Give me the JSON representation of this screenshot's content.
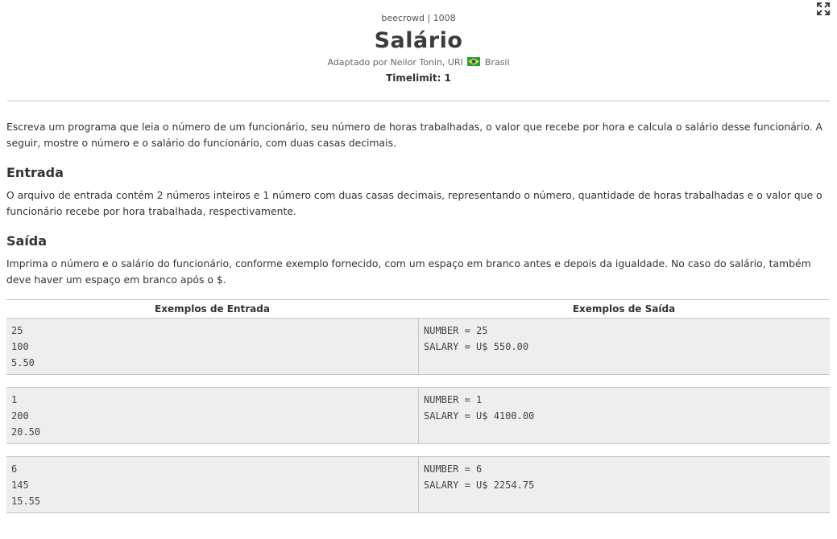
{
  "header": {
    "source": "beecrowd | 1008",
    "title": "Salário",
    "author_prefix": "Adaptado por Neilor Tonin, URI",
    "country": "Brasil",
    "flag_icon": "brazil-flag-icon",
    "timelimit": "Timelimit: 1"
  },
  "fullscreen_icon": "expand-icon",
  "description": "Escreva um programa que leia o número de um funcionário, seu número de horas trabalhadas, o valor que recebe por hora e calcula o salário desse funcionário. A seguir, mostre o número e o salário do funcionário, com duas casas decimais.",
  "input_section": {
    "heading": "Entrada",
    "text": "O arquivo de entrada contém 2 números inteiros e 1 número com duas casas decimais, representando o número, quantidade de horas trabalhadas e o valor que o funcionário recebe por hora trabalhada, respectivamente."
  },
  "output_section": {
    "heading": "Saída",
    "text": "Imprima o número e o salário do funcionário, conforme exemplo fornecido, com um espaço em branco antes e depois da igualdade. No caso do salário, também deve haver um espaço em branco após o $."
  },
  "examples": {
    "input_header": "Exemplos de Entrada",
    "output_header": "Exemplos de Saída",
    "items": [
      {
        "input": "25\n100\n5.50",
        "output": "NUMBER = 25\nSALARY = U$ 550.00"
      },
      {
        "input": "1\n200\n20.50",
        "output": "NUMBER = 1\nSALARY = U$ 4100.00"
      },
      {
        "input": "6\n145\n15.55",
        "output": "NUMBER = 6\nSALARY = U$ 2254.75"
      }
    ]
  },
  "colors": {
    "example_bg": "#eeeeee",
    "border": "#c8c8c8",
    "text": "#333333"
  }
}
